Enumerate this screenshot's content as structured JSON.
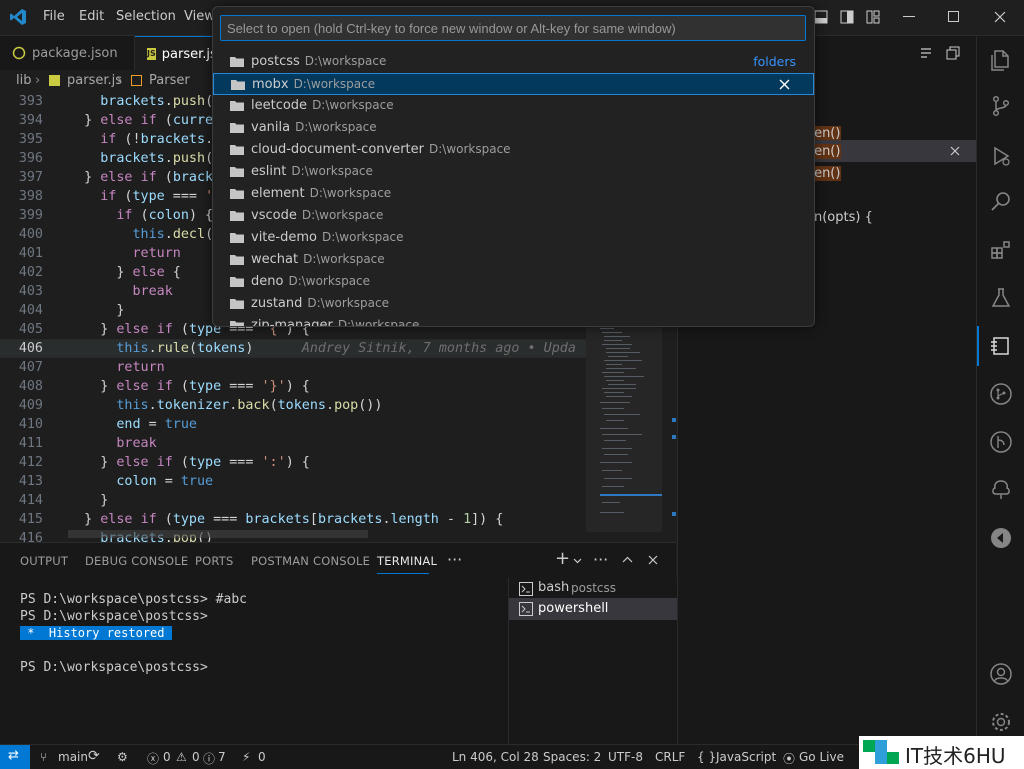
{
  "menu": {
    "file": "File",
    "edit": "Edit",
    "selection": "Selection",
    "view": "View"
  },
  "tabs": [
    {
      "label": "package.json",
      "icon": "npm-icon"
    },
    {
      "label": "parser.js",
      "icon": "js-file-icon"
    }
  ],
  "breadcrumb": {
    "folder": "lib",
    "file": "parser.js",
    "symbol": "Parser"
  },
  "quickpick": {
    "placeholder": "Select to open (hold Ctrl-key to force new window or Alt-key for same window)",
    "group_label": "folders",
    "items": [
      {
        "name": "postcss",
        "path": "D:\\workspace"
      },
      {
        "name": "mobx",
        "path": "D:\\workspace"
      },
      {
        "name": "leetcode",
        "path": "D:\\workspace"
      },
      {
        "name": "vanila",
        "path": "D:\\workspace"
      },
      {
        "name": "cloud-document-converter",
        "path": "D:\\workspace"
      },
      {
        "name": "eslint",
        "path": "D:\\workspace"
      },
      {
        "name": "element",
        "path": "D:\\workspace"
      },
      {
        "name": "vscode",
        "path": "D:\\workspace"
      },
      {
        "name": "vite-demo",
        "path": "D:\\workspace"
      },
      {
        "name": "wechat",
        "path": "D:\\workspace"
      },
      {
        "name": "deno",
        "path": "D:\\workspace"
      },
      {
        "name": "zustand",
        "path": "D:\\workspace"
      },
      {
        "name": "zip-manager",
        "path": "D:\\workspace"
      }
    ],
    "selected_index": 1
  },
  "editor": {
    "line_numbers": [
      "393",
      "394",
      "395",
      "396",
      "397",
      "398",
      "399",
      "400",
      "401",
      "402",
      "403",
      "404",
      "405",
      "406",
      "407",
      "408",
      "409",
      "410",
      "411",
      "412",
      "413",
      "414",
      "415",
      "416"
    ],
    "current_line": "406",
    "blame": "Andrey Sitnik, 7 months ago • Upda"
  },
  "right_panel": {
    "items": [
      "ken()",
      "ken()",
      "ken()",
      "en(opts) {"
    ]
  },
  "panel_tabs": [
    "OUTPUT",
    "DEBUG CONSOLE",
    "PORTS",
    "POSTMAN CONSOLE",
    "TERMINAL"
  ],
  "active_panel_tab": "TERMINAL",
  "terminal": {
    "lines": [
      "PS D:\\workspace\\postcss> #abc",
      "PS D:\\workspace\\postcss>"
    ],
    "history_badge": " *  History restored ",
    "prompt": "PS D:\\workspace\\postcss>"
  },
  "terminal_list": [
    {
      "name": "bash",
      "desc": "postcss"
    },
    {
      "name": "powershell",
      "desc": ""
    }
  ],
  "status": {
    "branch": "main",
    "errors": "0",
    "warnings": "0",
    "info": "7",
    "ports": "0",
    "position": "Ln 406, Col 28",
    "spaces": "Spaces: 2",
    "encoding": "UTF-8",
    "eol": "CRLF",
    "language": "JavaScript",
    "golive": "Go Live"
  },
  "watermark": "IT技术6HU",
  "colors": {
    "accent": "#0078d4",
    "selected": "#04395e",
    "status_remote": "#0078d4"
  }
}
